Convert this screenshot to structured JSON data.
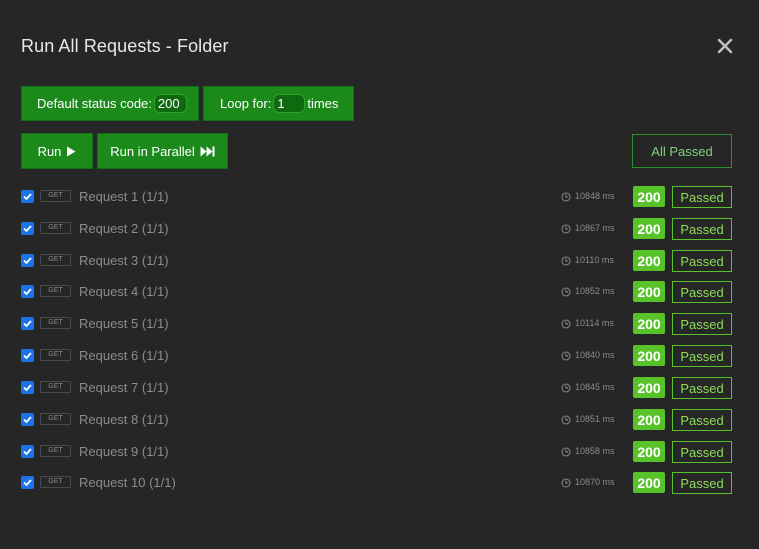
{
  "dialog": {
    "title": "Run All Requests - Folder"
  },
  "config": {
    "status_label": "Default status code:",
    "status_value": "200",
    "loop_label": "Loop for:",
    "loop_value": "1",
    "loop_suffix": "times"
  },
  "actions": {
    "run_label": "Run",
    "parallel_label": "Run in Parallel"
  },
  "summary": "All Passed",
  "colors": {
    "background": "#262626",
    "button_green": "#1b8a1b",
    "success_green": "#57c22a",
    "checkbox_blue": "#1a73e8"
  },
  "requests": [
    {
      "method": "GET",
      "name": "Request 1 (1/1)",
      "time": "10848 ms",
      "code": "200",
      "result": "Passed"
    },
    {
      "method": "GET",
      "name": "Request 2 (1/1)",
      "time": "10867 ms",
      "code": "200",
      "result": "Passed"
    },
    {
      "method": "GET",
      "name": "Request 3 (1/1)",
      "time": "10110 ms",
      "code": "200",
      "result": "Passed"
    },
    {
      "method": "GET",
      "name": "Request 4 (1/1)",
      "time": "10852 ms",
      "code": "200",
      "result": "Passed"
    },
    {
      "method": "GET",
      "name": "Request 5 (1/1)",
      "time": "10114 ms",
      "code": "200",
      "result": "Passed"
    },
    {
      "method": "GET",
      "name": "Request 6 (1/1)",
      "time": "10840 ms",
      "code": "200",
      "result": "Passed"
    },
    {
      "method": "GET",
      "name": "Request 7 (1/1)",
      "time": "10845 ms",
      "code": "200",
      "result": "Passed"
    },
    {
      "method": "GET",
      "name": "Request 8 (1/1)",
      "time": "10851 ms",
      "code": "200",
      "result": "Passed"
    },
    {
      "method": "GET",
      "name": "Request 9 (1/1)",
      "time": "10858 ms",
      "code": "200",
      "result": "Passed"
    },
    {
      "method": "GET",
      "name": "Request 10 (1/1)",
      "time": "10870 ms",
      "code": "200",
      "result": "Passed"
    }
  ]
}
